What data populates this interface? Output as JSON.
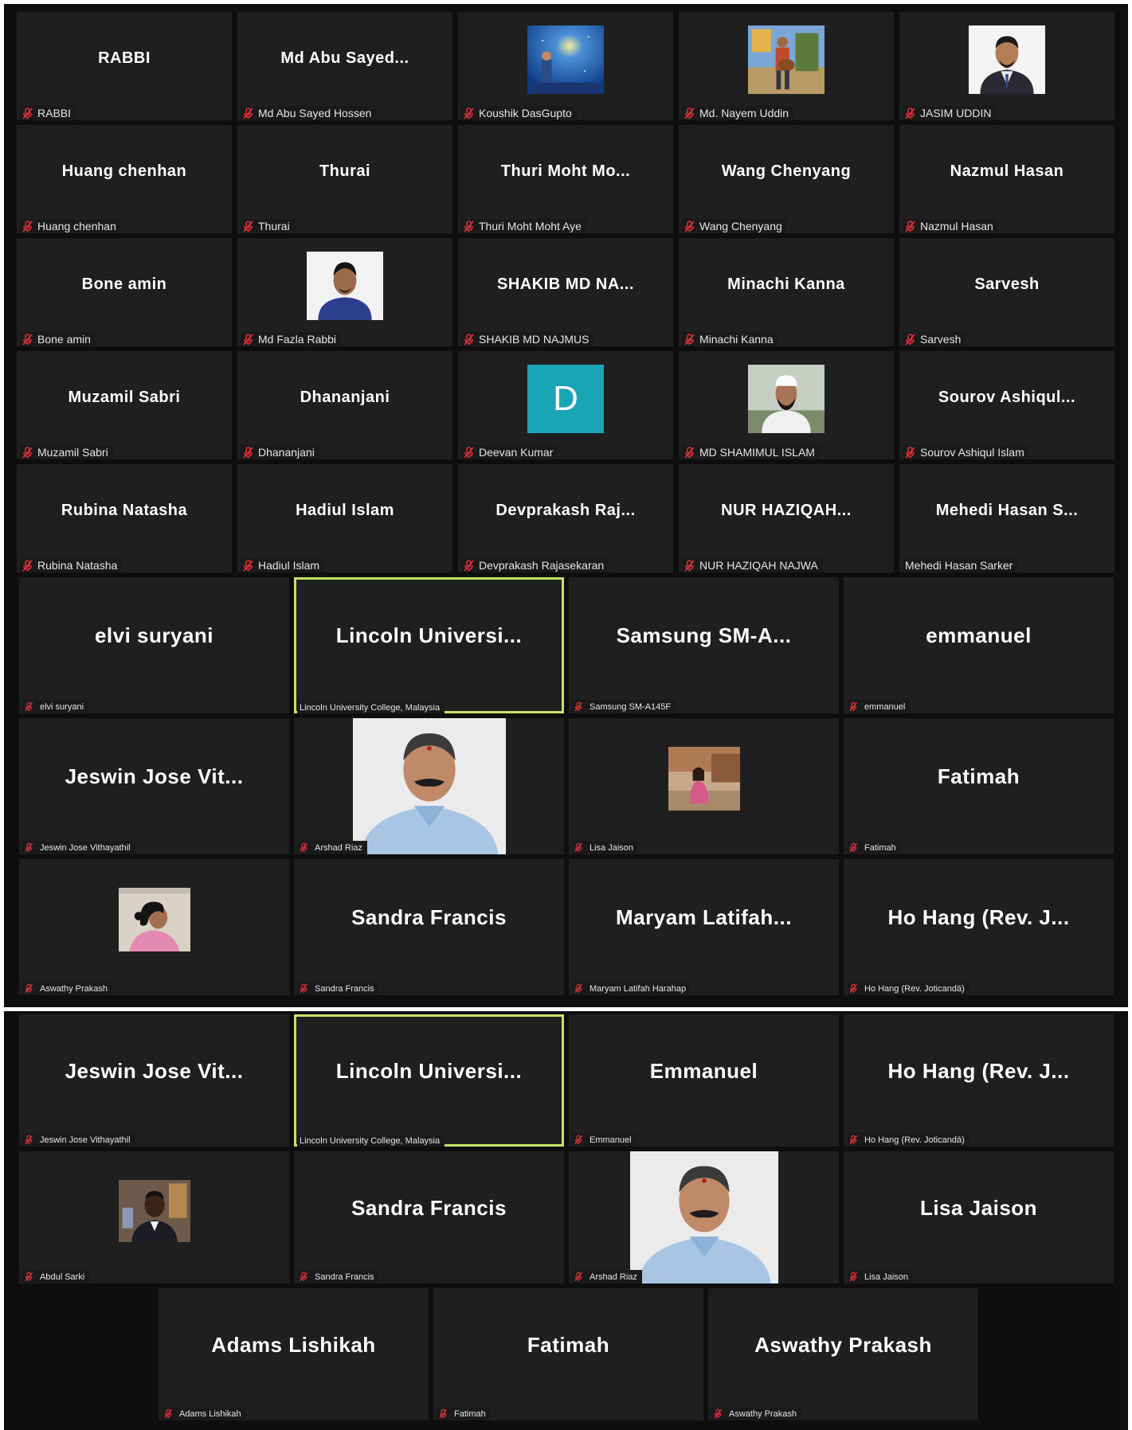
{
  "panel1": {
    "tiles": [
      {
        "title": "RABBI",
        "label": "RABBI",
        "muted": true
      },
      {
        "title": "Md  Abu  Sayed...",
        "label": "Md Abu Sayed Hossen",
        "muted": true
      },
      {
        "title": "",
        "label": "Koushik DasGupto",
        "muted": true,
        "avatar": "photo-night-sky"
      },
      {
        "title": "",
        "label": "Md. Nayem Uddin",
        "muted": true,
        "avatar": "photo-guitar"
      },
      {
        "title": "",
        "label": "JASIM UDDIN",
        "muted": true,
        "avatar": "photo-portrait-suit"
      },
      {
        "title": "Huang chenhan",
        "label": "Huang chenhan",
        "muted": true
      },
      {
        "title": "Thurai",
        "label": "Thurai",
        "muted": true
      },
      {
        "title": "Thuri  Moht  Mo...",
        "label": "Thuri Moht Moht Aye",
        "muted": true
      },
      {
        "title": "Wang Chenyang",
        "label": "Wang Chenyang",
        "muted": true
      },
      {
        "title": "Nazmul Hasan",
        "label": "Nazmul Hasan",
        "muted": true
      },
      {
        "title": "Bone amin",
        "label": "Bone amin",
        "muted": true
      },
      {
        "title": "",
        "label": "Md Fazla Rabbi",
        "muted": true,
        "avatar": "photo-portrait-blue"
      },
      {
        "title": "SHAKIB  MD  NA...",
        "label": "SHAKIB MD NAJMUS",
        "muted": true
      },
      {
        "title": "Minachi Kanna",
        "label": "Minachi Kanna",
        "muted": true
      },
      {
        "title": "Sarvesh",
        "label": "Sarvesh",
        "muted": true
      },
      {
        "title": "Muzamil Sabri",
        "label": "Muzamil Sabri",
        "muted": true
      },
      {
        "title": "Dhananjani",
        "label": "Dhananjani",
        "muted": true
      },
      {
        "title": "",
        "label": "Deevan Kumar",
        "muted": true,
        "avatar": "letter",
        "letter": "D"
      },
      {
        "title": "",
        "label": "MD SHAMIMUL ISLAM",
        "muted": true,
        "avatar": "photo-portrait-cap"
      },
      {
        "title": "Sourov  Ashiqul...",
        "label": "Sourov Ashiqul Islam",
        "muted": true
      },
      {
        "title": "Rubina Natasha",
        "label": "Rubina Natasha",
        "muted": true
      },
      {
        "title": "Hadiul Islam",
        "label": "Hadiul Islam",
        "muted": true
      },
      {
        "title": "Devprakash  Raj...",
        "label": "Devprakash Rajasekaran",
        "muted": true
      },
      {
        "title": "NUR  HAZIQAH...",
        "label": "NUR HAZIQAH NAJWA",
        "muted": true
      },
      {
        "title": "Mehedi  Hasan  S...",
        "label": "Mehedi Hasan Sarker",
        "muted": false
      }
    ]
  },
  "panel2": {
    "tiles": [
      {
        "title": "elvi suryani",
        "label": "elvi suryani",
        "muted": true
      },
      {
        "title": "Lincoln  Universi...",
        "label": "Lincoln University College, Malaysia",
        "muted": false,
        "active": true
      },
      {
        "title": "Samsung  SM-A...",
        "label": "Samsung SM-A145F",
        "muted": true
      },
      {
        "title": "emmanuel",
        "label": "emmanuel",
        "muted": true
      },
      {
        "title": "Jeswin Jose Vit...",
        "label": "Jeswin Jose Vithayathil",
        "muted": true
      },
      {
        "title": "",
        "label": "Arshad Riaz",
        "muted": true,
        "avatar": "photo-man-video"
      },
      {
        "title": "",
        "label": "Lisa Jaison",
        "muted": true,
        "avatar": "photo-woman-outdoor"
      },
      {
        "title": "Fatimah",
        "label": "Fatimah",
        "muted": true
      },
      {
        "title": "",
        "label": "Aswathy Prakash",
        "muted": true,
        "avatar": "photo-woman-profile"
      },
      {
        "title": "Sandra Francis",
        "label": "Sandra Francis",
        "muted": true
      },
      {
        "title": "Maryam  Latifah...",
        "label": "Maryam Latifah Harahap",
        "muted": true
      },
      {
        "title": "Ho Hang (Rev. J...",
        "label": "Ho Hang (Rev. Joticandā)",
        "muted": true
      }
    ]
  },
  "panel3": {
    "tiles": [
      {
        "title": "Jeswin Jose Vit...",
        "label": "Jeswin Jose Vithayathil",
        "muted": true
      },
      {
        "title": "Lincoln  Universi...",
        "label": "Lincoln University College, Malaysia",
        "muted": false,
        "active": true
      },
      {
        "title": "Emmanuel",
        "label": "Emmanuel",
        "muted": true
      },
      {
        "title": "Ho Hang (Rev. J...",
        "label": "Ho Hang (Rev. Joticandā)",
        "muted": true
      },
      {
        "title": "",
        "label": "Abdul Sarki",
        "muted": true,
        "avatar": "photo-man-suit"
      },
      {
        "title": "Sandra Francis",
        "label": "Sandra Francis",
        "muted": true
      },
      {
        "title": "",
        "label": "Arshad Riaz",
        "muted": true,
        "avatar": "photo-man-video"
      },
      {
        "title": "Lisa Jaison",
        "label": "Lisa Jaison",
        "muted": true
      },
      {
        "title": "Adams Lishikah",
        "label": "Adams Lishikah",
        "muted": true
      },
      {
        "title": "Fatimah",
        "label": "Fatimah",
        "muted": true
      },
      {
        "title": "Aswathy Prakash",
        "label": "Aswathy Prakash",
        "muted": true
      }
    ]
  },
  "colors": {
    "background": "#0e0e0e",
    "tile": "#1f1f1f",
    "active_border": "#c6e36a",
    "mute": "#e0303a",
    "text": "#ffffff"
  }
}
